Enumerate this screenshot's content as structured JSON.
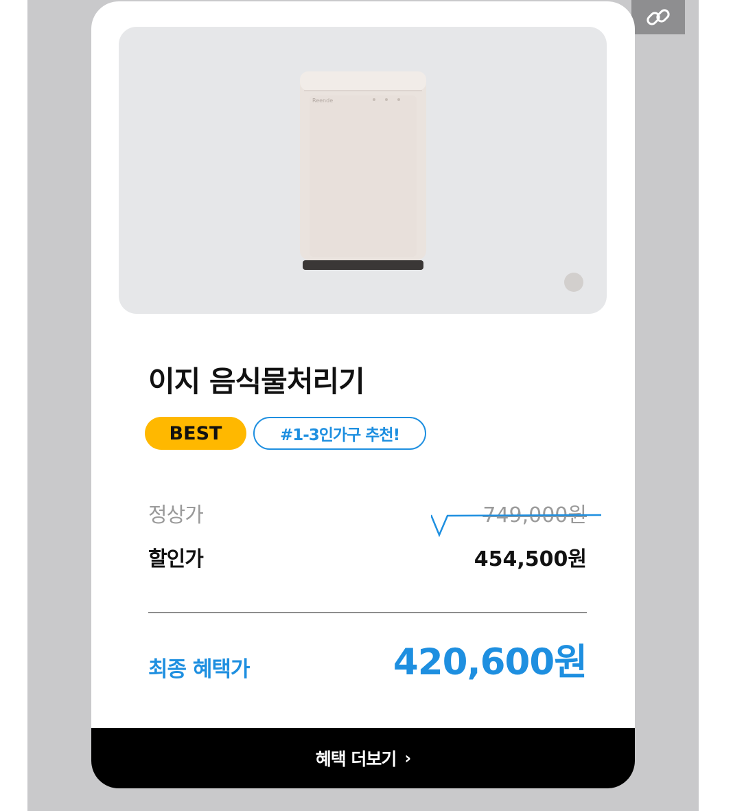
{
  "product": {
    "brand_text": "Reende",
    "title": "이지 음식물처리기",
    "badges": {
      "best": "BEST",
      "tag": "#1-3인가구 추천!"
    }
  },
  "carousel": {
    "total": 1,
    "current": 1
  },
  "prices": {
    "regular_label": "정상가",
    "regular_value": "749,000원",
    "discount_label": "할인가",
    "discount_value": "454,500원",
    "final_label": "최종 혜택가",
    "final_value": "420,600원"
  },
  "actions": {
    "more_label": "혜택 더보기",
    "more_icon": "chevron-right-icon",
    "link_icon": "link-icon"
  },
  "colors": {
    "accent_blue": "#1e8fe0",
    "best_badge": "#ffb800",
    "button_bg": "#000000",
    "panel_gray": "#c9c9cb",
    "image_bg": "#e6e7e9"
  }
}
